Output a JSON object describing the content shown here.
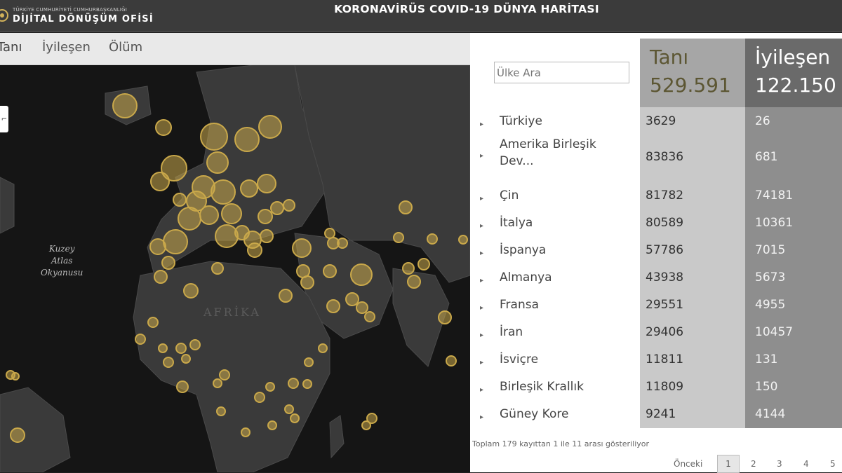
{
  "header": {
    "org_small": "TÜRKİYE CUMHURİYETİ CUMHURBAŞKANLIĞI",
    "org_name": "DİJİTAL DÖNÜŞÜM OFİSİ",
    "title": "KORONAVİRÜS COVID-19 DÜNYA HARİTASI"
  },
  "tabs": [
    {
      "label": "Tanı"
    },
    {
      "label": "İyileşen"
    },
    {
      "label": "Ölüm"
    }
  ],
  "map": {
    "ocean_label": "Kuzey\nAtlas\nOkyanusu",
    "continent_label": "AFRİKA",
    "marker_color": "#c9a84a"
  },
  "search": {
    "placeholder": "Ülke Ara"
  },
  "totals": {
    "tani_label": "Tanı",
    "tani_value": "529.591",
    "iyilesen_label": "İyileşen",
    "iyilesen_value": "122.150"
  },
  "rows": [
    {
      "country": "Türkiye",
      "tani": "3629",
      "iyilesen": "26"
    },
    {
      "country": "Amerika Birleşik Dev...",
      "tani": "83836",
      "iyilesen": "681"
    },
    {
      "country": "Çin",
      "tani": "81782",
      "iyilesen": "74181"
    },
    {
      "country": "İtalya",
      "tani": "80589",
      "iyilesen": "10361"
    },
    {
      "country": "İspanya",
      "tani": "57786",
      "iyilesen": "7015"
    },
    {
      "country": "Almanya",
      "tani": "43938",
      "iyilesen": "5673"
    },
    {
      "country": "Fransa",
      "tani": "29551",
      "iyilesen": "4955"
    },
    {
      "country": "İran",
      "tani": "29406",
      "iyilesen": "10457"
    },
    {
      "country": "İsviçre",
      "tani": "11811",
      "iyilesen": "131"
    },
    {
      "country": "Birleşik Krallık",
      "tani": "11809",
      "iyilesen": "150"
    },
    {
      "country": "Güney Kore",
      "tani": "9241",
      "iyilesen": "4144"
    }
  ],
  "footer": {
    "info": "Toplam 179 kayıttan 1 ile 11 arası gösteriliyor",
    "prev": "Önceki",
    "pages": [
      "1",
      "2",
      "3",
      "4",
      "5"
    ]
  }
}
